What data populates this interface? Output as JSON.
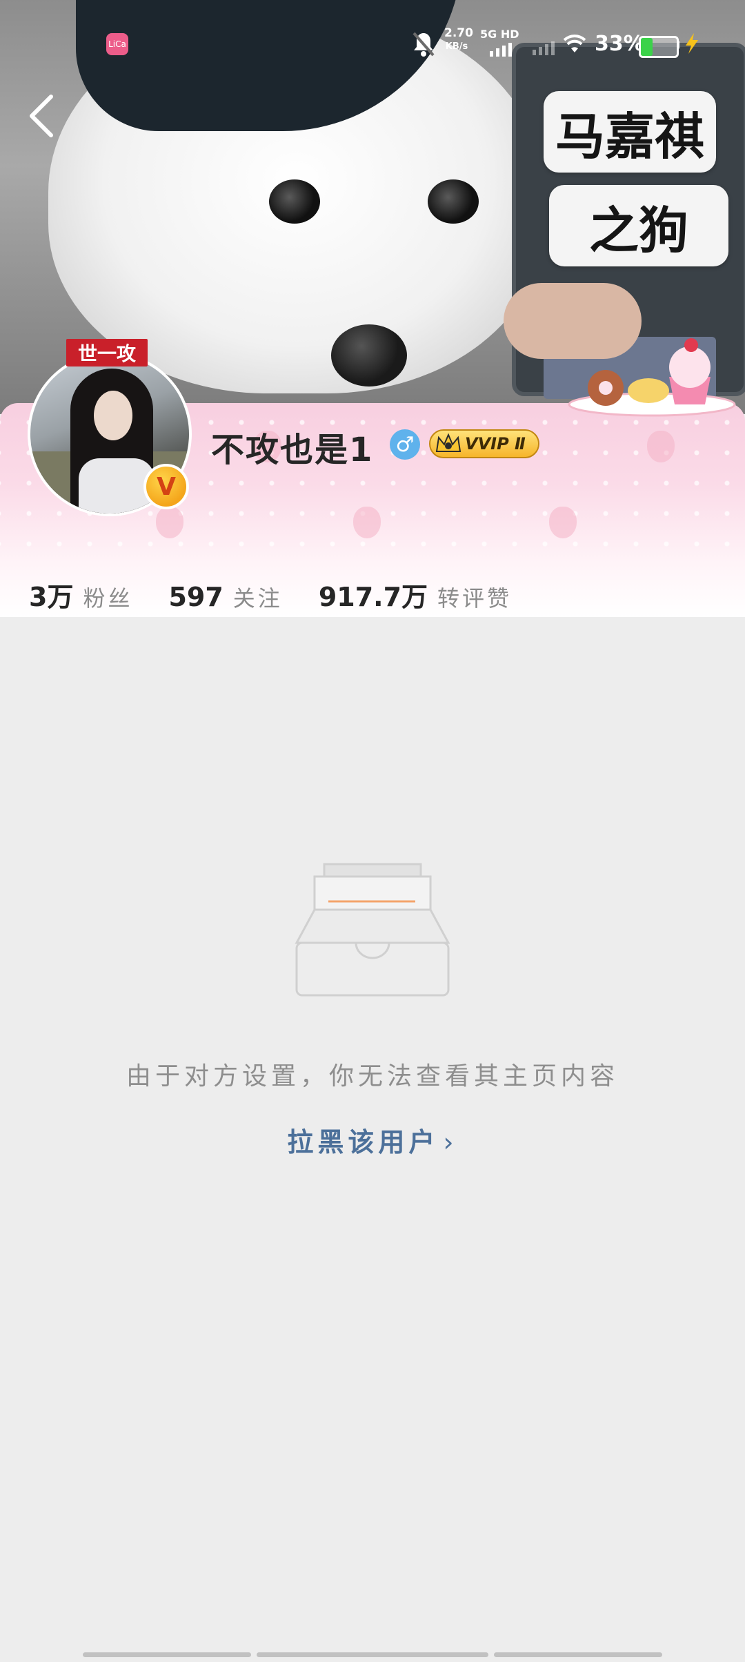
{
  "status_bar": {
    "app_badge": "LiCa",
    "net_speed_value": "2.70",
    "net_speed_unit": "KB/s",
    "network_type": "5G HD",
    "battery_percent": "33%",
    "battery_level": 0.33
  },
  "banner": {
    "sign_line1": "马嘉祺",
    "sign_line2": "之狗"
  },
  "profile": {
    "avatar_tag": "世一攻",
    "verified_badge": "V",
    "username": "不攻也是1",
    "gender_symbol": "♂",
    "vip_label": "VVIP Ⅱ"
  },
  "stats": [
    {
      "value": "3万",
      "label": "粉丝"
    },
    {
      "value": "597",
      "label": "关注"
    },
    {
      "value": "917.7万",
      "label": "转评赞"
    }
  ],
  "empty_state": {
    "message": "由于对方设置，你无法查看其主页内容",
    "block_link": "拉黑该用户",
    "block_chevron": "›"
  },
  "colors": {
    "accent_link": "#4c709a",
    "card_pink": "#f8cfe0",
    "background": "#ededed"
  },
  "icons": [
    "back-arrow-icon",
    "mute-bell-icon",
    "wifi-icon",
    "battery-icon",
    "charging-bolt-icon",
    "male-icon",
    "crown-icon",
    "empty-box-icon"
  ]
}
